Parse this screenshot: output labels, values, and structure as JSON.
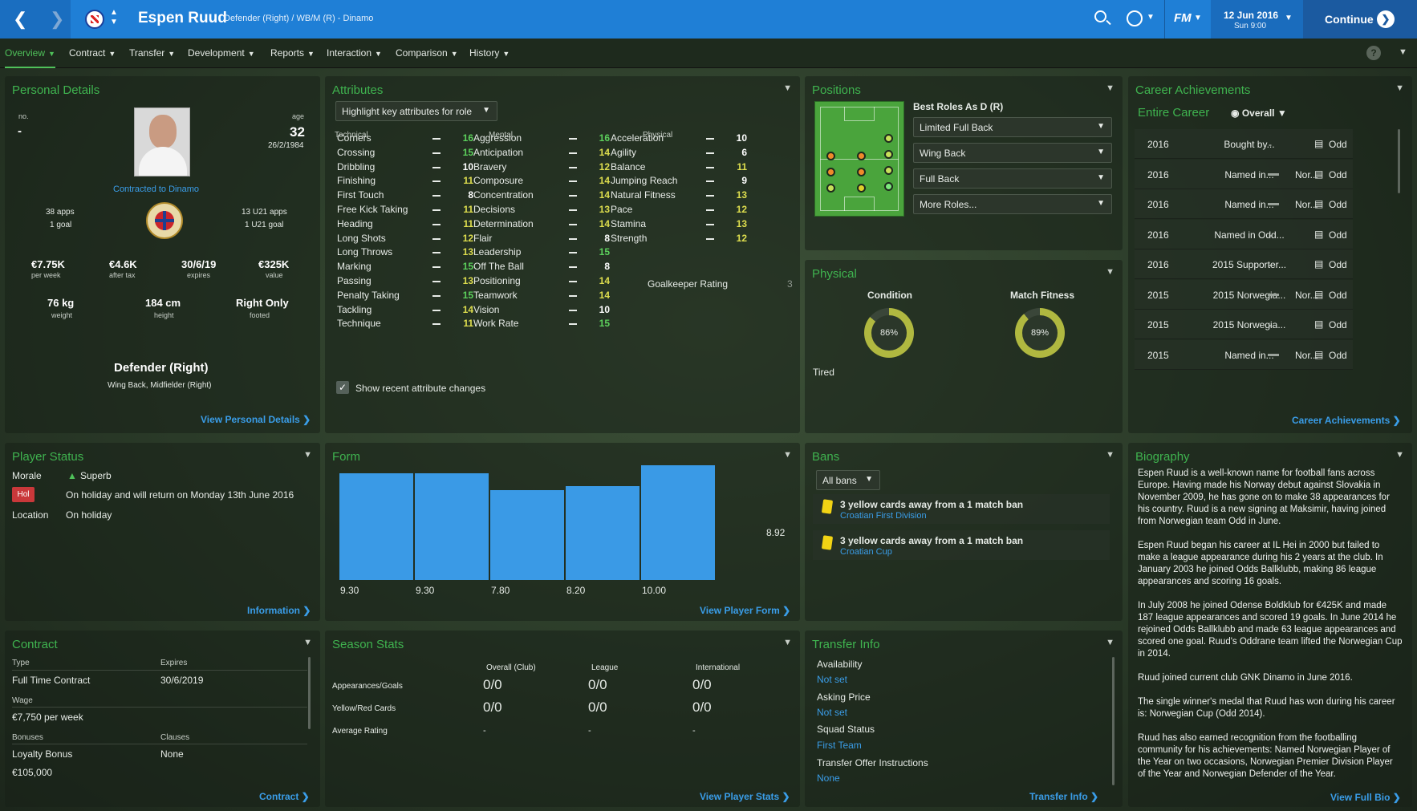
{
  "header": {
    "player_name": "Espen Ruud",
    "subtitle": "Defender (Right) / WB/M (R) - Dinamo",
    "date": "12 Jun 2016",
    "time": "Sun 9:00",
    "continue_label": "Continue",
    "fm_label": "FM"
  },
  "nav": {
    "items": [
      "Overview",
      "Contract",
      "Transfer",
      "Development",
      "Reports",
      "Interaction",
      "Comparison",
      "History"
    ]
  },
  "personal": {
    "title": "Personal Details",
    "no_label": "no.",
    "no_value": "-",
    "age_label": "age",
    "age_value": "32",
    "dob": "26/2/1984",
    "contracted": "Contracted to Dinamo",
    "apps": "38 apps",
    "goals": "1 goal",
    "u21_apps": "13 U21 apps",
    "u21_goals": "1 U21 goal",
    "wage": "€7.75K",
    "wage_lbl": "per week",
    "after_tax": "€4.6K",
    "after_tax_lbl": "after tax",
    "expires": "30/6/19",
    "expires_lbl": "expires",
    "value": "€325K",
    "value_lbl": "value",
    "weight": "76 kg",
    "weight_lbl": "weight",
    "height": "184 cm",
    "height_lbl": "height",
    "foot": "Right Only",
    "foot_lbl": "footed",
    "position": "Defender (Right)",
    "alt_positions": "Wing Back, Midfielder (Right)",
    "link": "View Personal Details"
  },
  "attributes": {
    "title": "Attributes",
    "highlight": "Highlight key attributes for role",
    "tech_header": "Technical",
    "mental_header": "Mental",
    "physical_header": "Physical",
    "technical": [
      [
        "Corners",
        "16"
      ],
      [
        "Crossing",
        "15"
      ],
      [
        "Dribbling",
        "10"
      ],
      [
        "Finishing",
        "11"
      ],
      [
        "First Touch",
        "8"
      ],
      [
        "Free Kick Taking",
        "11"
      ],
      [
        "Heading",
        "11"
      ],
      [
        "Long Shots",
        "12"
      ],
      [
        "Long Throws",
        "13"
      ],
      [
        "Marking",
        "15"
      ],
      [
        "Passing",
        "13"
      ],
      [
        "Penalty Taking",
        "15"
      ],
      [
        "Tackling",
        "14"
      ],
      [
        "Technique",
        "11"
      ]
    ],
    "mental": [
      [
        "Aggression",
        "16"
      ],
      [
        "Anticipation",
        "14"
      ],
      [
        "Bravery",
        "12"
      ],
      [
        "Composure",
        "14"
      ],
      [
        "Concentration",
        "14"
      ],
      [
        "Decisions",
        "13"
      ],
      [
        "Determination",
        "14"
      ],
      [
        "Flair",
        "8"
      ],
      [
        "Leadership",
        "15"
      ],
      [
        "Off The Ball",
        "8"
      ],
      [
        "Positioning",
        "14"
      ],
      [
        "Teamwork",
        "14"
      ],
      [
        "Vision",
        "10"
      ],
      [
        "Work Rate",
        "15"
      ]
    ],
    "physical": [
      [
        "Acceleration",
        "10"
      ],
      [
        "Agility",
        "6"
      ],
      [
        "Balance",
        "11"
      ],
      [
        "Jumping Reach",
        "9"
      ],
      [
        "Natural Fitness",
        "13"
      ],
      [
        "Pace",
        "12"
      ],
      [
        "Stamina",
        "13"
      ],
      [
        "Strength",
        "12"
      ]
    ],
    "gk_label": "Goalkeeper Rating",
    "gk_value": "3",
    "show_changes": "Show recent attribute changes"
  },
  "positions": {
    "title": "Positions",
    "best_roles": "Best Roles As D (R)",
    "roles": [
      "Limited Full Back",
      "Wing Back",
      "Full Back",
      "More Roles..."
    ]
  },
  "physical": {
    "title": "Physical",
    "condition_lbl": "Condition",
    "condition": "86%",
    "condition_val": 0.86,
    "fitness_lbl": "Match Fitness",
    "fitness": "89%",
    "fitness_val": 0.89,
    "status": "Tired"
  },
  "career": {
    "title": "Career Achievements",
    "scope": "Entire Career",
    "filter": "Overall",
    "link": "Career Achievements",
    "rows": [
      [
        "2016",
        "Bought by...",
        "-",
        "Odd"
      ],
      [
        "2016",
        "Named in...",
        "Nor...",
        "Odd"
      ],
      [
        "2016",
        "Named in...",
        "Nor...",
        "Odd"
      ],
      [
        "2016",
        "Named in Odd...",
        "-",
        "Odd"
      ],
      [
        "2016",
        "2015 Supporter...",
        "-",
        "Odd"
      ],
      [
        "2015",
        "2015 Norwegia...",
        "Nor...",
        "Odd"
      ],
      [
        "2015",
        "2015 Norwegia...",
        "-",
        "Odd"
      ],
      [
        "2015",
        "Named in...",
        "Nor...",
        "Odd"
      ]
    ]
  },
  "status": {
    "title": "Player Status",
    "morale_lbl": "Morale",
    "morale": "Superb",
    "hol_badge": "Hol",
    "holiday": "On holiday and will return on Monday 13th June 2016",
    "location_lbl": "Location",
    "location": "On holiday",
    "link": "Information"
  },
  "form": {
    "title": "Form",
    "link": "View Player Form",
    "avg": "8.92"
  },
  "chart_data": {
    "type": "bar",
    "categories": [
      "1",
      "2",
      "3",
      "4",
      "5"
    ],
    "values": [
      9.3,
      9.3,
      7.8,
      8.2,
      10.0
    ],
    "labels": [
      "9.30",
      "9.30",
      "7.80",
      "8.20",
      "10.00"
    ],
    "average": 8.92
  },
  "bans": {
    "title": "Bans",
    "filter": "All bans",
    "items": [
      [
        "3 yellow cards away from a 1 match ban",
        "Croatian First Division"
      ],
      [
        "3 yellow cards away from a 1 match ban",
        "Croatian Cup"
      ]
    ]
  },
  "biography": {
    "title": "Biography",
    "link": "View Full Bio",
    "paras": [
      "Espen Ruud is a well-known name for football fans across Europe. Having made his Norway debut against Slovakia in November 2009, he has gone on to make 38 appearances for his country. Ruud is a new signing at Maksimir, having joined from Norwegian team Odd in June.",
      "Espen Ruud began his career at IL Hei in 2000 but failed to make a league appearance during his 2 years at the club. In January 2003 he joined Odds Ballklubb, making 86 league appearances and scoring 16 goals.",
      "In July 2008 he joined Odense Boldklub for €425K and made 187 league appearances and scored 19 goals. In June 2014 he rejoined Odds Ballklubb and made 63 league appearances and scored one goal. Ruud's Oddrane team lifted the Norwegian Cup in 2014.",
      "Ruud joined current club GNK Dinamo in June 2016.",
      "The single winner's medal that Ruud has won during his career is: Norwegian Cup (Odd 2014).",
      "Ruud has also earned recognition from the footballing community for his achievements: Named Norwegian Player of the Year on two occasions, Norwegian Premier Division Player of the Year and Norwegian Defender of the Year."
    ]
  },
  "contract": {
    "title": "Contract",
    "type_lbl": "Type",
    "type": "Full Time Contract",
    "expires_lbl": "Expires",
    "expires": "30/6/2019",
    "wage_lbl": "Wage",
    "wage": "€7,750 per week",
    "bonuses_lbl": "Bonuses",
    "clauses_lbl": "Clauses",
    "bonus": "Loyalty Bonus",
    "clauses": "None",
    "bonus_amt": "€105,000",
    "link": "Contract"
  },
  "season": {
    "title": "Season Stats",
    "cols": [
      "Overall (Club)",
      "League",
      "International"
    ],
    "rows": [
      [
        "Appearances/Goals",
        "0/0",
        "0/0",
        "0/0"
      ],
      [
        "Yellow/Red Cards",
        "0/0",
        "0/0",
        "0/0"
      ],
      [
        "Average Rating",
        "-",
        "-",
        "-"
      ]
    ],
    "link": "View Player Stats"
  },
  "transfer": {
    "title": "Transfer Info",
    "availability_lbl": "Availability",
    "availability": "Not set",
    "price_lbl": "Asking Price",
    "price": "Not set",
    "squad_lbl": "Squad Status",
    "squad": "First Team",
    "offer_lbl": "Transfer Offer Instructions",
    "offer": "None",
    "link": "Transfer Info"
  }
}
